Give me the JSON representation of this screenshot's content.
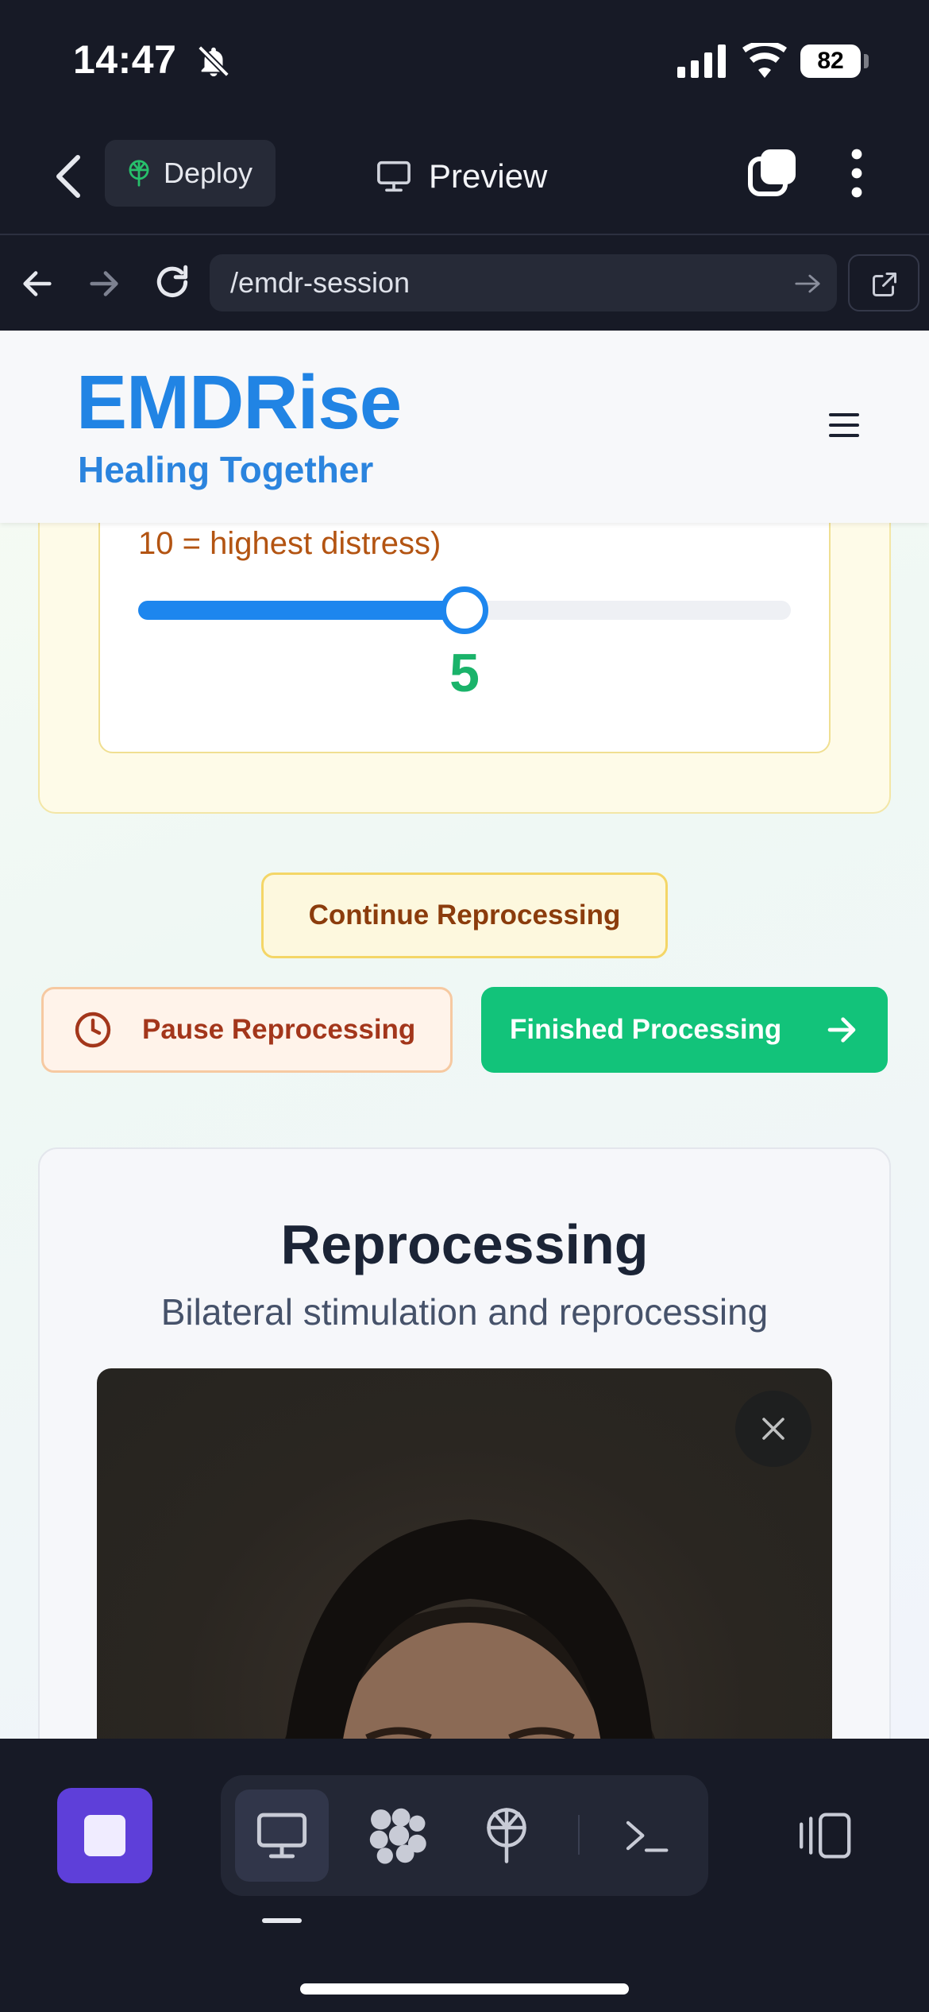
{
  "status_bar": {
    "time": "14:47",
    "battery": "82"
  },
  "top_bar": {
    "deploy_label": "Deploy",
    "preview_label": "Preview"
  },
  "url_bar": {
    "url": "/emdr-session"
  },
  "site": {
    "brand": "EMDRise",
    "tagline": "Healing Together"
  },
  "sud": {
    "label": "10 = highest distress)",
    "value": "5",
    "value_fraction": 0.5
  },
  "actions": {
    "continue_label": "Continue Reprocessing",
    "pause_label": "Pause Reprocessing",
    "finish_label": "Finished Processing"
  },
  "reprocessing": {
    "title": "Reprocessing",
    "subtitle": "Bilateral stimulation and reprocessing"
  },
  "colors": {
    "brand_blue": "#2184e4",
    "accent_green": "#12c37a",
    "stop_purple": "#5e3fd9"
  },
  "icons": [
    "bell-off-icon",
    "signal-icon",
    "wifi-icon",
    "back-icon",
    "deploy-icon",
    "monitor-icon",
    "tabs-icon",
    "more-icon",
    "arrow-left-icon",
    "arrow-right-icon",
    "reload-icon",
    "open-external-icon",
    "hamburger-icon",
    "clock-icon",
    "close-icon",
    "stop-icon",
    "packages-icon",
    "terminal-icon",
    "panel-icon"
  ]
}
